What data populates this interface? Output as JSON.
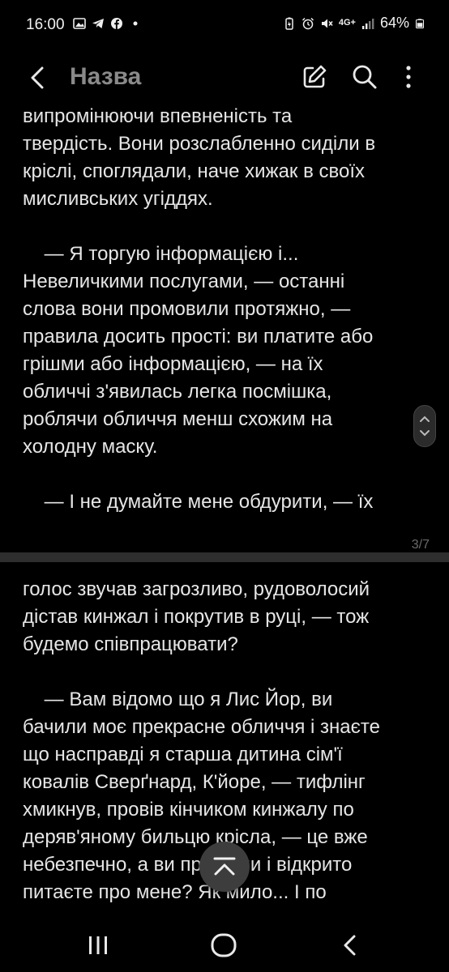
{
  "status_bar": {
    "time": "16:00",
    "network": "4G+",
    "battery": "64%",
    "left_icons": [
      "gallery-icon",
      "telegram-icon",
      "facebook-icon",
      "dot-icon"
    ],
    "right_icons": [
      "battery-saver-icon",
      "alarm-icon",
      "mute-icon",
      "network-icon",
      "signal-icon",
      "battery-icon"
    ]
  },
  "app_bar": {
    "title": "Назва",
    "actions": [
      "back-icon",
      "edit-icon",
      "search-icon",
      "more-icon"
    ]
  },
  "page_a": {
    "lines": [
      "випромінюючи впевненість та",
      "твердість. Вони розслабленно сиділи в",
      "кріслі, споглядали, наче хижак в своїх",
      "мисливських угіддях.",
      "",
      "    — Я торгую інформацією і...",
      "Невеличкими послугами, — останні",
      "слова вони промовили протяжно, —",
      "правила досить прості: ви платите або",
      "грішми або інформацією, — на їх",
      "обличчі з'явилась легка посмішка,",
      "роблячи обличчя менш схожим на",
      "холодну маску.",
      "",
      "    — І не думайте мене обдурити, — їх"
    ],
    "page_counter": "3/7"
  },
  "page_b": {
    "lines": [
      "голос звучав загрозливо, рудоволосий",
      "дістав кинжал і покрутив в руці, — тож",
      "будемо співпрацювати?",
      "",
      "    — Вам відомо що я Лис Йор, ви",
      "бачили моє прекрасне обличчя і знаєте",
      "що насправді я старша дитина сім'ї",
      "ковалів Сверґнард, К'йоре, — тифлінг",
      "хмикнув, провів кінчиком кинжалу по",
      "деряв'яному бильцю крісла, — це вже",
      "небезпечно, а ви прийшли і відкрито",
      "питаєте про мене? Як мило... І по"
    ]
  },
  "navigation_bar": {
    "buttons": [
      "recents-icon",
      "home-icon",
      "back-icon"
    ]
  }
}
